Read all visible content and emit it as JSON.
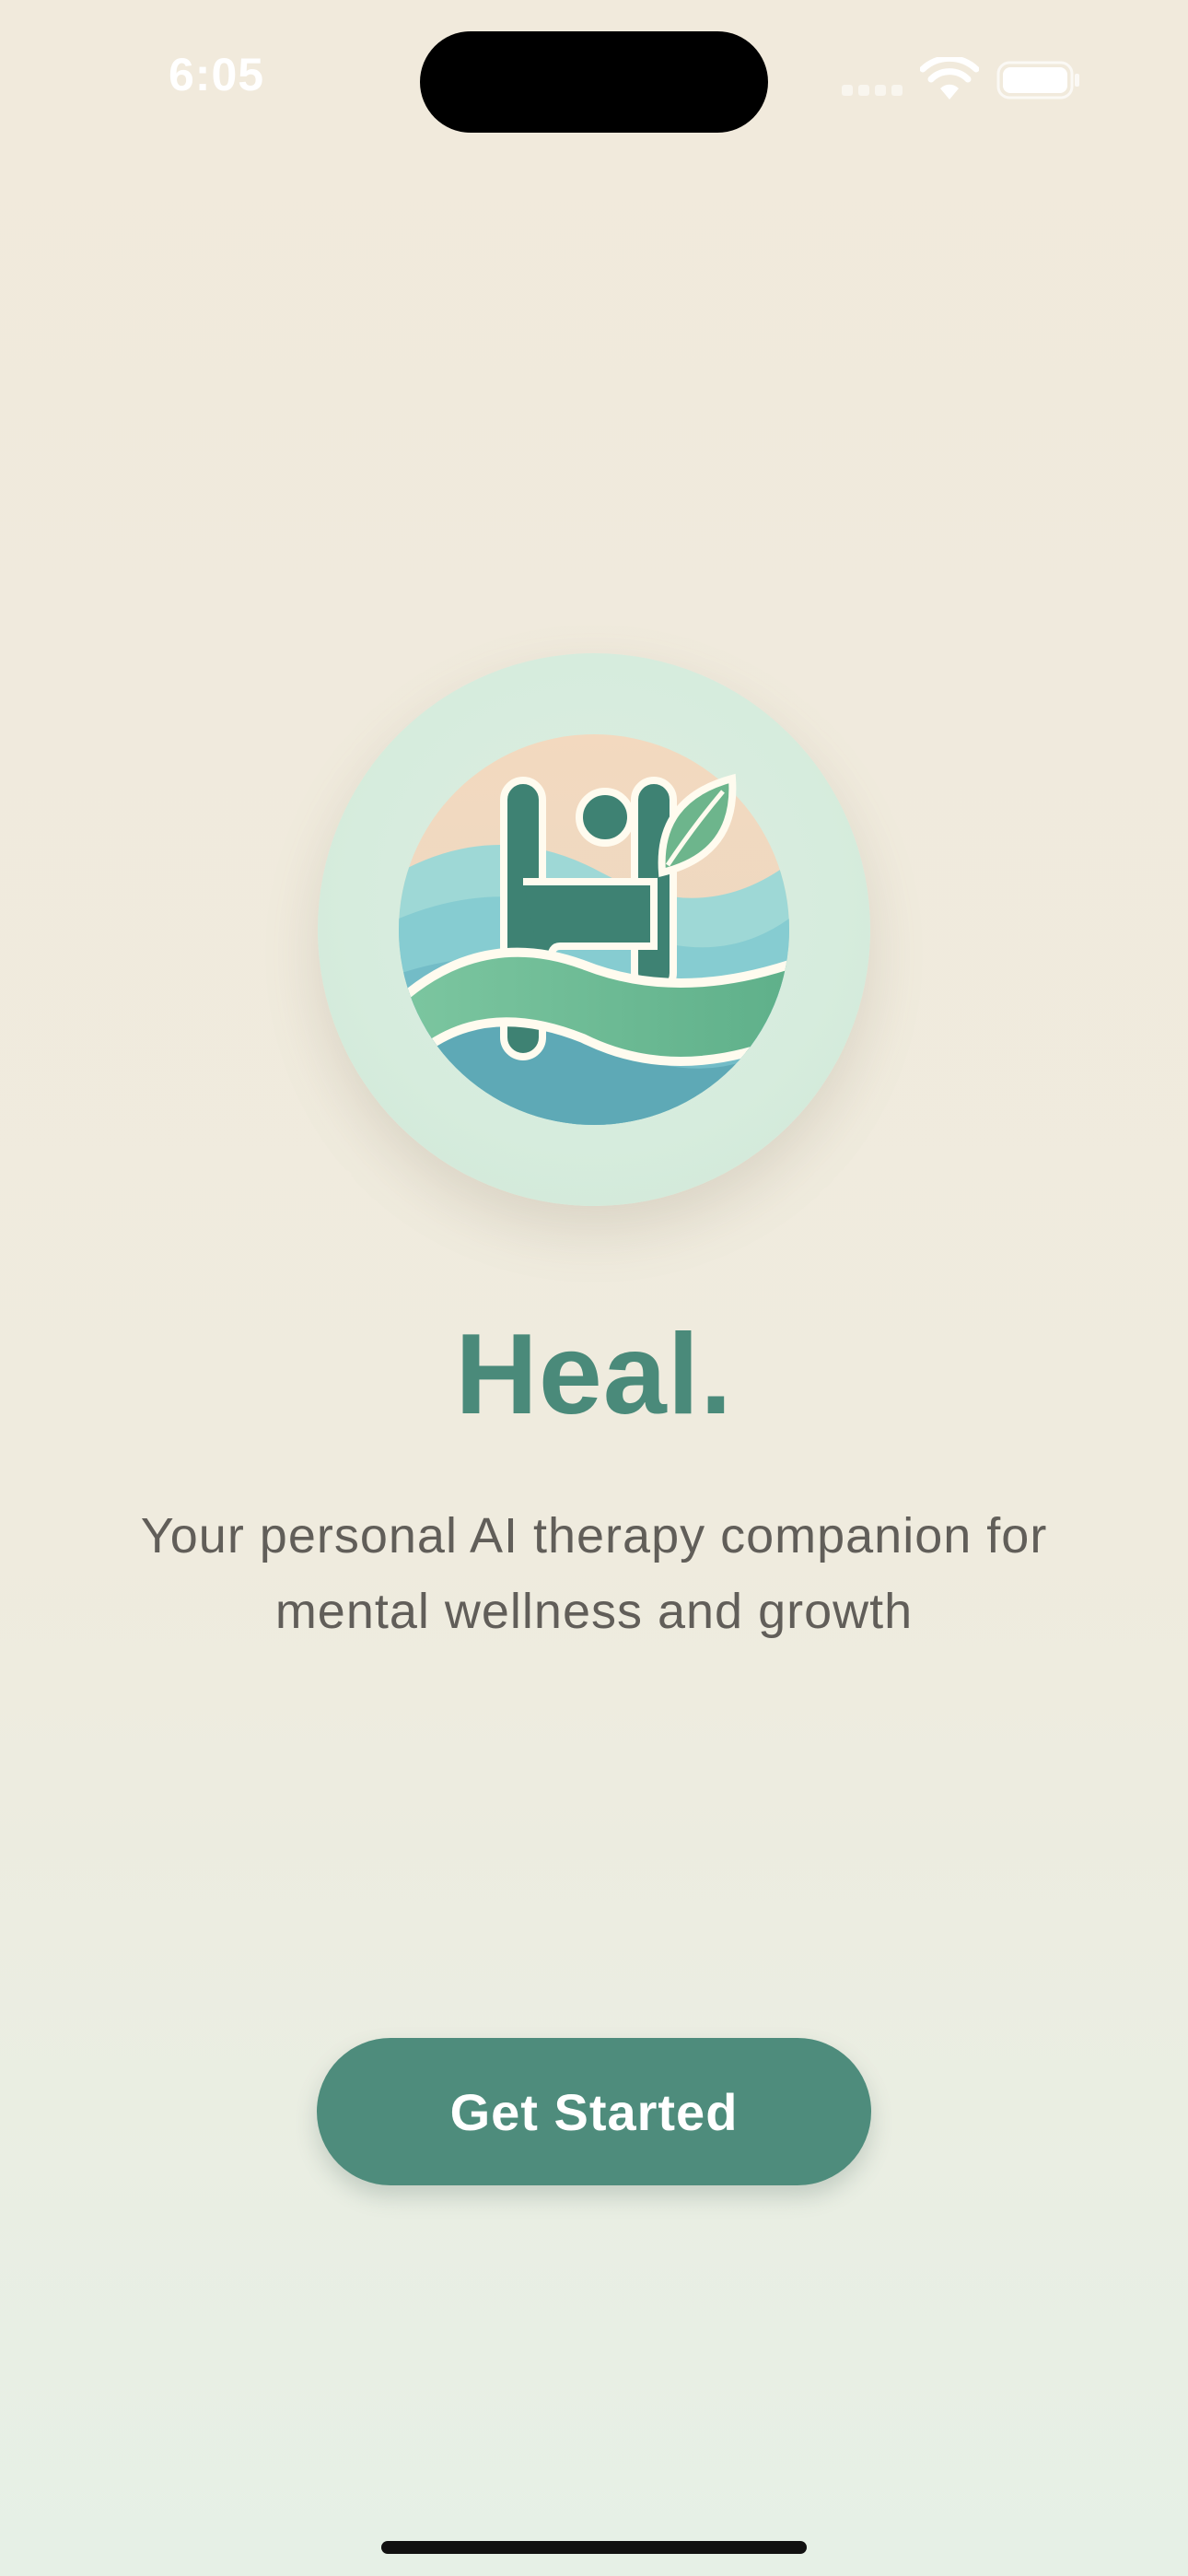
{
  "status_bar": {
    "time": "6:05",
    "icons": [
      "cellular-signal-icon",
      "wifi-icon",
      "battery-icon"
    ],
    "text_color": "#FFFFFF"
  },
  "logo": {
    "icon": "heal-logo-icon",
    "ring_color": "#D6ECDD"
  },
  "title": "Heal.",
  "tagline": "Your personal AI therapy companion for mental wellness and growth",
  "cta": {
    "label": "Get Started",
    "color": "#4E8C7C"
  },
  "colors": {
    "background": "#F1EADC",
    "title": "#4A8A7A",
    "body_text": "#615E59"
  }
}
